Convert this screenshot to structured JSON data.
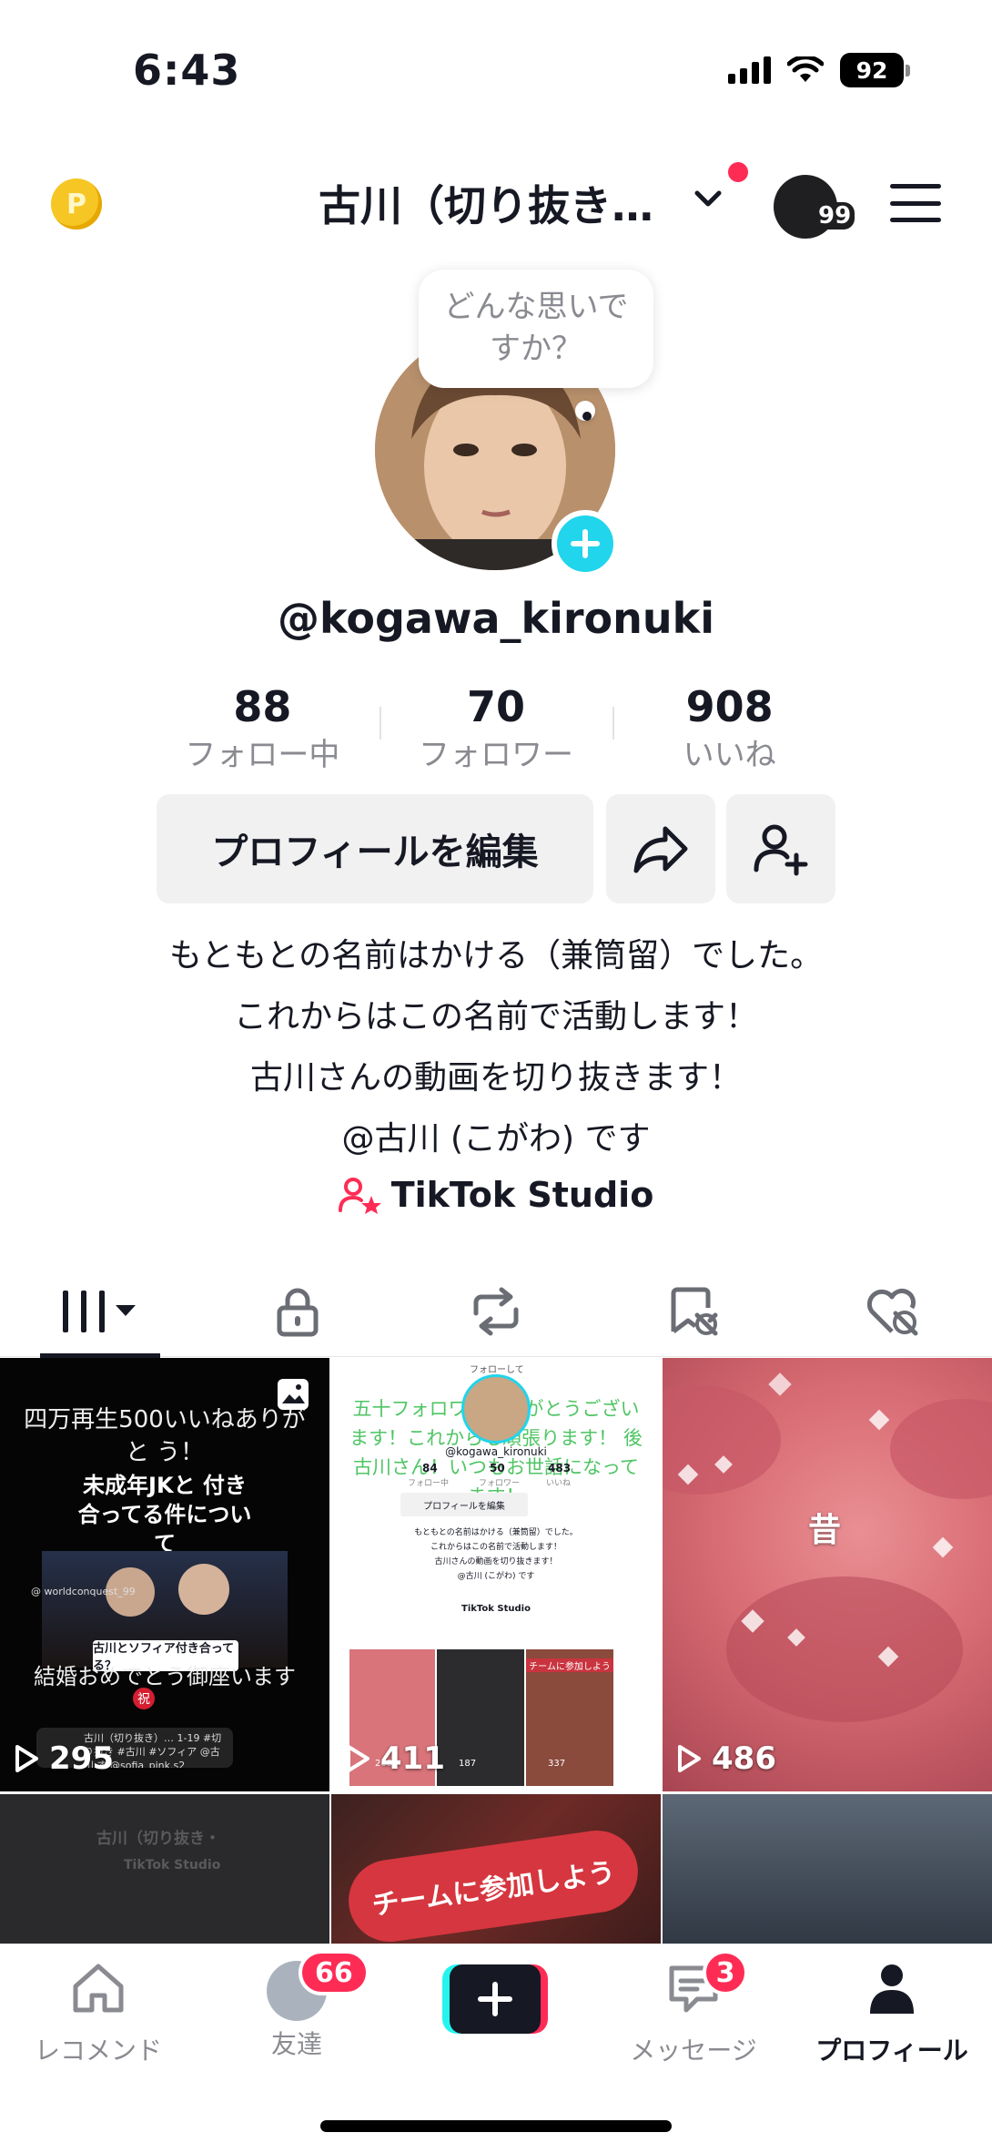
{
  "status_bar": {
    "time": "6:43",
    "battery": "92"
  },
  "header": {
    "coin": "P",
    "title": "古川（切り抜き…",
    "account_badge": "99"
  },
  "avatar": {
    "thought_bubble": [
      "どんな思いで",
      "すか？"
    ]
  },
  "profile": {
    "username": "@kogawa_kironuki"
  },
  "stats": [
    {
      "value": "88",
      "label": "フォロー中"
    },
    {
      "value": "70",
      "label": "フォロワー"
    },
    {
      "value": "908",
      "label": "いいね"
    }
  ],
  "actions": {
    "edit_profile": "プロフィールを編集"
  },
  "bio": [
    "もともとの名前はかける（兼筒留）でした。",
    "これからはこの名前で活動します！",
    "古川さんの動画を切り抜きます！",
    "@古川 (こがわ) です"
  ],
  "studio": {
    "label": "TikTok Studio"
  },
  "tabs": [
    {
      "icon": "grid-icon",
      "active": true
    },
    {
      "icon": "lock-icon",
      "active": false
    },
    {
      "icon": "repost-icon",
      "active": false
    },
    {
      "icon": "bookmark-icon",
      "active": false
    },
    {
      "icon": "liked-heart-icon",
      "active": false
    }
  ],
  "videos": [
    {
      "views": "295",
      "overlay": {
        "top": "四万再生500いいねありがと う！",
        "headline": "未成年JKと 付き合ってる件について",
        "caption": "古川とソフィア付き合ってる？",
        "bottom": "結婚おめでとう御座います",
        "tag": "祝",
        "handle": "@ worldconquest_99",
        "desc": "古川（切り抜き）…  1-19  #切り抜き #古川 #ソフィア @古川  す @sofia_pink.s2"
      }
    },
    {
      "views": "411",
      "overlay": {
        "title": "五十フォロワーありがとうございます！これからも頑張ります！ 後古川さん！いつもお世話になってます！",
        "bubble": "フォローして",
        "username": "@kogawa_kironuki",
        "stats": [
          "84",
          "50",
          "483"
        ],
        "stat_labels": [
          "フォロー中",
          "フォロワー",
          "いいね"
        ],
        "button": "プロフィールを編集",
        "bio": [
          "もともとの名前はかける（兼筒留）でした。",
          "これからはこの名前で活動します！",
          "古川さんの動画を切り抜きます！",
          "@古川 (こがわ) です"
        ],
        "studio": "TikTok Studio",
        "thumb_views": [
          "268",
          "187",
          "337"
        ],
        "thumb_label": "チームに参加しよう"
      }
    },
    {
      "views": "486",
      "overlay": {
        "text": "昔"
      }
    },
    {
      "views": "",
      "overlay": {
        "title": "古川（切り抜き・",
        "studio": "TikTok Studio"
      }
    },
    {
      "views": "",
      "overlay": {
        "text": "チームに参加しよう"
      }
    },
    {
      "views": "",
      "overlay": {}
    }
  ],
  "bottom_nav": [
    {
      "label": "レコメンド",
      "icon": "home-icon"
    },
    {
      "label": "友達",
      "icon": "friends-avatar-icon",
      "badge": "66"
    },
    {
      "label": "",
      "icon": "create-plus-icon"
    },
    {
      "label": "メッセージ",
      "icon": "inbox-icon",
      "badge": "3"
    },
    {
      "label": "プロフィール",
      "icon": "profile-icon",
      "active": true
    }
  ]
}
